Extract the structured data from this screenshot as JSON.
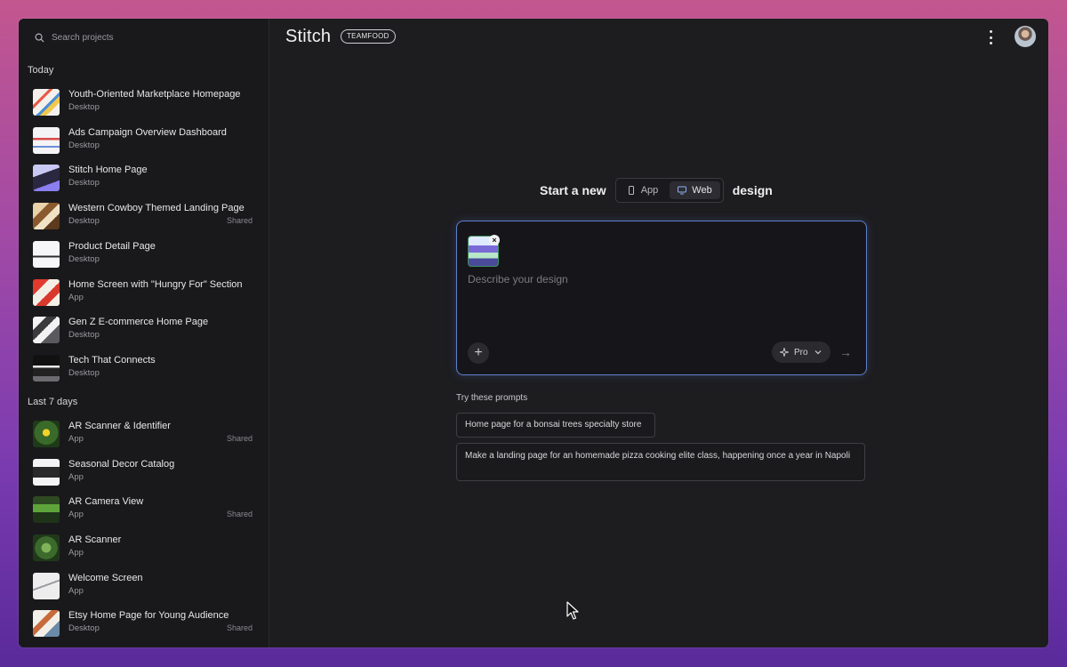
{
  "sidebar": {
    "search_placeholder": "Search projects",
    "sections": [
      {
        "heading": "Today",
        "items": [
          {
            "title": "Youth-Oriented Marketplace Homepage",
            "sub": "Desktop",
            "shared": ""
          },
          {
            "title": "Ads Campaign Overview Dashboard",
            "sub": "Desktop",
            "shared": ""
          },
          {
            "title": "Stitch Home Page",
            "sub": "Desktop",
            "shared": ""
          },
          {
            "title": "Western Cowboy Themed Landing Page",
            "sub": "Desktop",
            "shared": "Shared"
          },
          {
            "title": "Product Detail Page",
            "sub": "Desktop",
            "shared": ""
          },
          {
            "title": "Home Screen with \"Hungry For\" Section",
            "sub": "App",
            "shared": ""
          },
          {
            "title": "Gen Z E-commerce Home Page",
            "sub": "Desktop",
            "shared": ""
          },
          {
            "title": "Tech That Connects",
            "sub": "Desktop",
            "shared": ""
          }
        ]
      },
      {
        "heading": "Last 7 days",
        "items": [
          {
            "title": "AR Scanner & Identifier",
            "sub": "App",
            "shared": "Shared"
          },
          {
            "title": "Seasonal Decor Catalog",
            "sub": "App",
            "shared": ""
          },
          {
            "title": "AR Camera View",
            "sub": "App",
            "shared": "Shared"
          },
          {
            "title": "AR Scanner",
            "sub": "App",
            "shared": ""
          },
          {
            "title": "Welcome Screen",
            "sub": "App",
            "shared": ""
          },
          {
            "title": "Etsy Home Page for Young Audience",
            "sub": "Desktop",
            "shared": "Shared"
          }
        ]
      }
    ]
  },
  "header": {
    "logo": "Stitch",
    "badge": "TEAMFOOD"
  },
  "main": {
    "start_prefix": "Start a new",
    "start_suffix": "design",
    "toggle": {
      "app": "App",
      "web": "Web",
      "selected": "Web"
    },
    "prompt_placeholder": "Describe your design",
    "model": "Pro",
    "try_label": "Try these prompts",
    "suggestions": [
      "Home page for a bonsai trees specialty store",
      "Make a landing page for an homemade pizza cooking elite class, happening once a year in Napoli"
    ]
  },
  "colors": {
    "accent_border": "#5f7fd0",
    "window_bg": "#1d1d20",
    "sidebar_bg": "#19191b"
  }
}
